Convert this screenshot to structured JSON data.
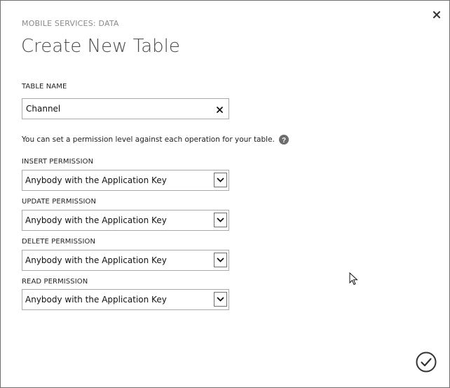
{
  "dialog": {
    "subtitle": "MOBILE SERVICES: DATA",
    "title": "Create New Table"
  },
  "table_name": {
    "label": "TABLE NAME",
    "value": "Channel"
  },
  "help_text": "You can set a permission level against each operation for your table.",
  "permissions": [
    {
      "label": "INSERT PERMISSION",
      "value": "Anybody with the Application Key"
    },
    {
      "label": "UPDATE PERMISSION",
      "value": "Anybody with the Application Key"
    },
    {
      "label": "DELETE PERMISSION",
      "value": "Anybody with the Application Key"
    },
    {
      "label": "READ PERMISSION",
      "value": "Anybody with the Application Key"
    }
  ],
  "icons": {
    "close": "close-icon",
    "clear": "clear-input-icon",
    "help": "help-icon",
    "dropdown": "chevron-down-icon",
    "confirm": "checkmark-circle-icon",
    "cursor": "mouse-pointer-icon"
  },
  "colors": {
    "border": "#a9a9a9",
    "title": "#4a4a4a",
    "subtitle": "#8a8a8a",
    "help_icon": "#6d6d6d"
  }
}
